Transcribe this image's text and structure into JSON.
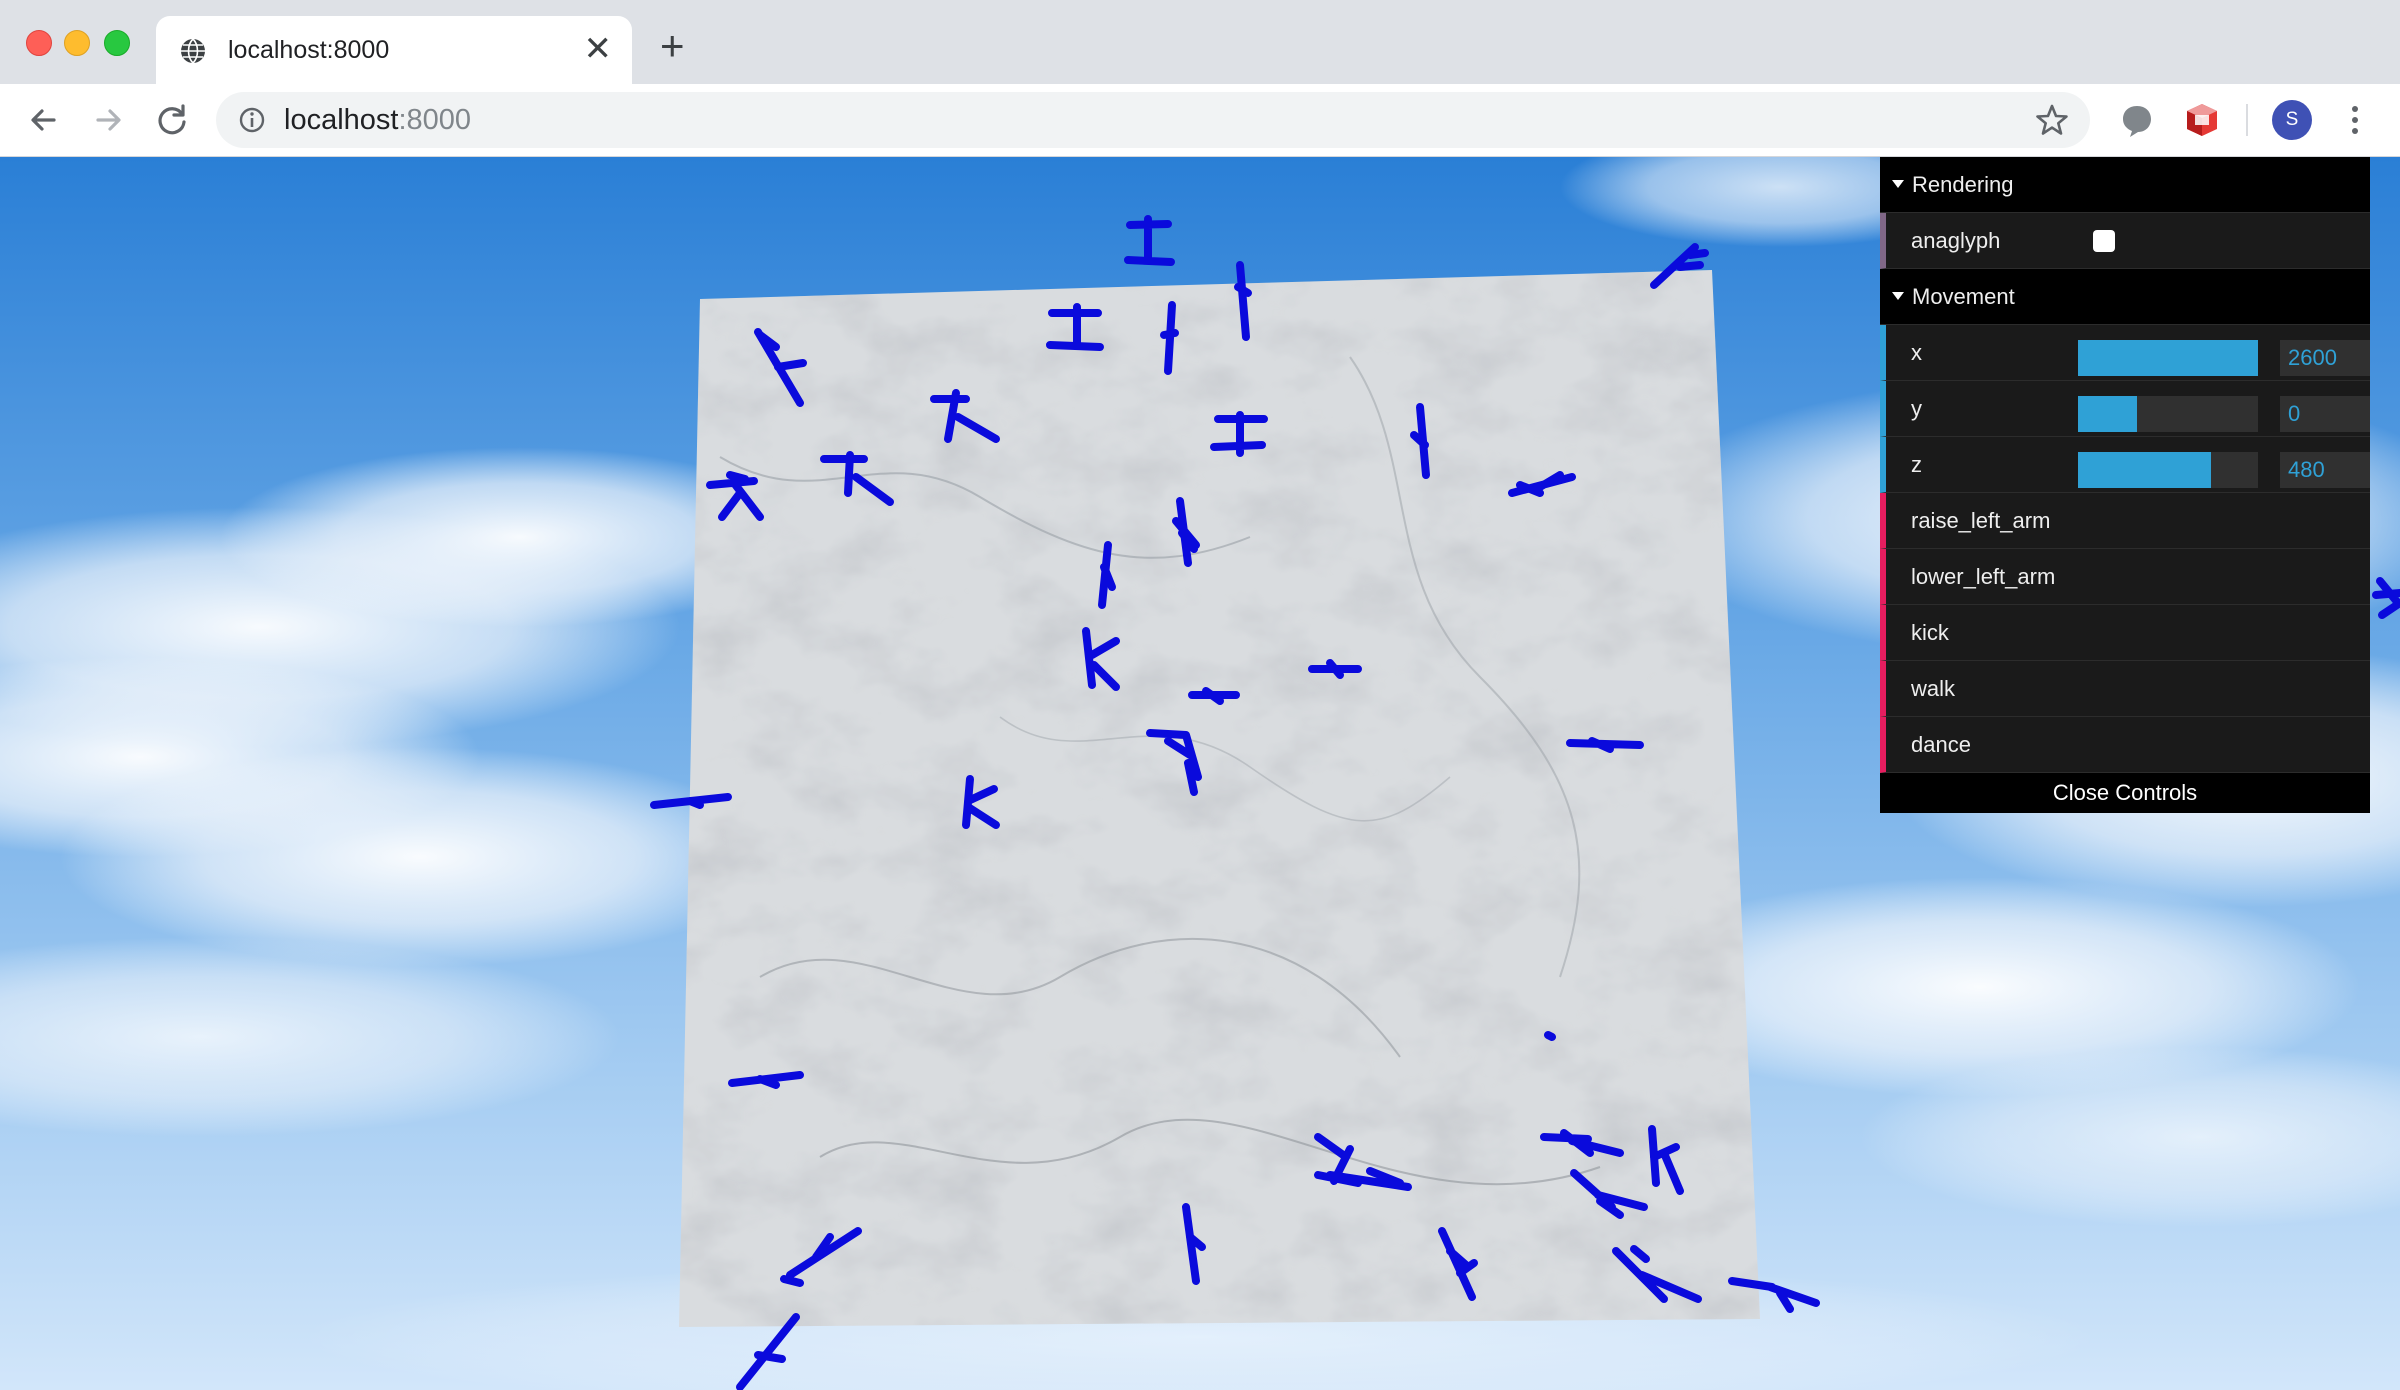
{
  "browser": {
    "tab_title": "localhost:8000",
    "url_host": "localhost",
    "url_port": ":8000",
    "avatar_letter": "S"
  },
  "gui": {
    "folders": [
      {
        "label": "Rendering"
      },
      {
        "label": "Movement"
      }
    ],
    "anaglyph": {
      "label": "anaglyph",
      "checked": false
    },
    "x": {
      "label": "x",
      "value": "2600",
      "fill": 1.0
    },
    "y": {
      "label": "y",
      "value": "0",
      "fill": 0.33
    },
    "z": {
      "label": "z",
      "value": "480",
      "fill": 0.74
    },
    "actions": [
      "raise_left_arm",
      "lower_left_arm",
      "kick",
      "walk",
      "dance"
    ],
    "close_label": "Close Controls"
  },
  "colors": {
    "figure": "#0a0adc",
    "slider": "#2fa1d6",
    "function_accent": "#e61d5f",
    "number_accent": "#2fa1d6"
  }
}
